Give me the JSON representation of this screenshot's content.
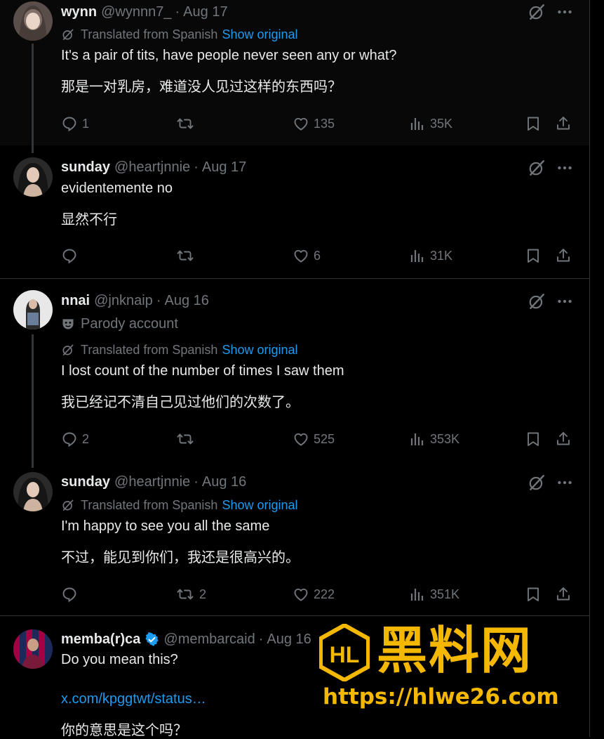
{
  "posts": [
    {
      "name": "wynn",
      "handle": "@wynnn7_",
      "time": "Aug 17",
      "translated": "Translated from Spanish",
      "show_original": "Show original",
      "text_en": "It's a pair of tits, have people never seen any or what?",
      "text_zh": "那是一对乳房，难道没人见过这样的东西吗？",
      "replies": "1",
      "reposts": "",
      "likes": "135",
      "views": "35K"
    },
    {
      "name": "sunday",
      "handle": "@heartjnnie",
      "time": "Aug 17",
      "text_en": "evidentemente no",
      "text_zh": "显然不行",
      "replies": "",
      "reposts": "",
      "likes": "6",
      "views": "31K"
    },
    {
      "name": "nnai",
      "handle": "@jnknaip",
      "time": "Aug 16",
      "parody": "Parody account",
      "translated": "Translated from Spanish",
      "show_original": "Show original",
      "text_en": "I lost count of the number of times I saw them",
      "text_zh": "我已经记不清自己见过他们的次数了。",
      "replies": "2",
      "reposts": "",
      "likes": "525",
      "views": "353K"
    },
    {
      "name": "sunday",
      "handle": "@heartjnnie",
      "time": "Aug 16",
      "translated": "Translated from Spanish",
      "show_original": "Show original",
      "text_en": "I'm happy to see you all the same",
      "text_zh": "不过，能见到你们，我还是很高兴的。",
      "replies": "",
      "reposts": "2",
      "likes": "222",
      "views": "351K"
    },
    {
      "name": "memba(r)ca",
      "handle": "@membarcaid",
      "time": "Aug 16",
      "text_en": "Do you mean this?",
      "link": "x.com/kpggtwt/status…",
      "text_zh": "你的意思是这个吗？"
    }
  ],
  "watermark": {
    "brand": "黑料网",
    "url": "https://hlwe26.com",
    "logo_text": "HL"
  },
  "colors": {
    "background": "#000000",
    "text": "#e7e9ea",
    "muted": "#71767b",
    "link": "#1d9bf0",
    "verified": "#1d9bf0",
    "watermark": "#f5b800"
  }
}
